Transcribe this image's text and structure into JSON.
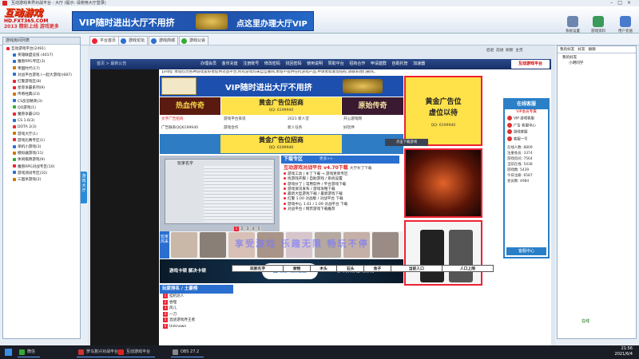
{
  "window": {
    "title": "互动游戏世界对战平台 - 大厅 (提示: 请使用大厅登录)"
  },
  "header": {
    "logo_text": "互动游戏",
    "logo_url": "HD.FXT365.COM",
    "logo_slogan": "2013 精彩上线 游戏更多",
    "banner_left": "VIP随时进出大厅不用挤",
    "banner_right": "点这里办理大厅VIP",
    "tools": [
      {
        "label": "系统设置"
      },
      {
        "label": "游戏资料"
      },
      {
        "label": "用户充值"
      }
    ]
  },
  "tabs": [
    {
      "label": "平台首页"
    },
    {
      "label": "游戏论坛"
    },
    {
      "label": "游戏商城"
    },
    {
      "label": "游戏公会"
    }
  ],
  "left_panel": {
    "title": "游戏房间列表",
    "items": [
      {
        "label": "互动游戏平台(2491)",
        "color": "#e23"
      },
      {
        "label": "英雄联盟竞技 (4017)",
        "color": "#2a6fd0"
      },
      {
        "label": "魔兽RPG专区(3)",
        "color": "#2a6fd0"
      },
      {
        "label": "帝国时代(17)",
        "color": "#c70"
      },
      {
        "label": "对战平台游戏 (一起大游戏)(687)",
        "color": "#2a6fd0"
      },
      {
        "label": "红警游戏区(8)",
        "color": "#e23"
      },
      {
        "label": "星际争霸系列(9)",
        "color": "#e23"
      },
      {
        "label": "传奇经典(23)",
        "color": "#c70"
      },
      {
        "label": "CS反恐精英(3)",
        "color": "#2a6fd0"
      },
      {
        "label": "QQ游戏(1)",
        "color": "#3a3"
      },
      {
        "label": "魔兽争霸(20)",
        "color": "#e23"
      },
      {
        "label": "CS 1.6(3)",
        "color": "#2a6fd0"
      },
      {
        "label": "DOTA 2(3)",
        "color": "#e23"
      },
      {
        "label": "游戏大厅(1)",
        "color": "#c70"
      },
      {
        "label": "游戏比赛专区(1)",
        "color": "#e23"
      },
      {
        "label": "单机小游戏(3)",
        "color": "#2a6fd0"
      },
      {
        "label": "模拟器游戏(11)",
        "color": "#c70"
      },
      {
        "label": "休闲棋牌游戏(9)",
        "color": "#3a3"
      },
      {
        "label": "魔兽RPG对战专区(10)",
        "color": "#e23"
      },
      {
        "label": "游戏测试专区(10)",
        "color": "#2a6fd0"
      },
      {
        "label": "三国杀游戏(2)",
        "color": "#c70"
      }
    ],
    "game_btn": "游戏大厅"
  },
  "nav": {
    "back": "后退",
    "forward": "前进",
    "refresh": "刷新",
    "home": "主页"
  },
  "site": {
    "home": "首页 > 最新公告",
    "nav_items": [
      "办理会员",
      "金币充值",
      "注册账号",
      "修改密码",
      "找回密码",
      "使用说明",
      "赞助平台",
      "招商合作",
      "申请建群",
      "自助托管",
      "加速器"
    ],
    "logo": "互动游戏平台",
    "notice": "【声明】本站仅为各种游戏爱好者提供对战平台,所有游戏均来自互联网,本站不提供任何游戏产品,申请者如发现侵权,请联系我们删除。",
    "banner_text": "VIP随时进出大厅不用挤",
    "ad_left": "热血传奇",
    "ad_mid_title": "黄金广告位招商",
    "ad_mid_sub": "QQ: 6199940",
    "ad_right": "原始传奇",
    "links": [
      {
        "text": "文字广告招商"
      },
      {
        "text": "游戏平台资讯"
      },
      {
        "text": "2021 新人堂"
      },
      {
        "text": "开心游戏网"
      },
      {
        "text": "广告联系QQ6199940"
      },
      {
        "text": "游戏合作"
      },
      {
        "text": "新人任务"
      },
      {
        "text": "好玩伴"
      }
    ],
    "gold_title": "黄金广告位招商",
    "gold_sub": "QQ: 6199940",
    "tooltip": "点击下载游戏"
  },
  "download": {
    "header": "下载专区",
    "more": "更多>>",
    "head": "互动游戏对战平台 v4.70下载",
    "head_tag": "大厅补丁下载",
    "rows": [
      "游戏工具 | 补丁下载 → 游戏更新专区",
      "找游戏开服 / 自助游戏 / 系统设置",
      "游戏补丁 | 常用软件 / 平台游戏下载",
      "游戏资讯发布 / 游戏攻略下载",
      "最新大型游戏下载 / 最新游戏下载",
      "红警 1.00 对战版 / 对战平台 下载",
      "游戏中心 1.61 / 1.09 对战平台 下载",
      "对战平台 / 网页游戏下载推荐"
    ],
    "slide_title": "玩家名字",
    "pages": [
      "1",
      "2",
      "3",
      "4",
      "5"
    ]
  },
  "photos": {
    "label": "玩家风采"
  },
  "promo": {
    "left": "游戏卡顿 解决卡顿",
    "center": "互动游戏加速器",
    "right": "永不掉线 游戏畅玩"
  },
  "watermark": "享受游戏 乐趣无限 畅玩不停",
  "rank": {
    "title": "玩家排名 / 土豪榜",
    "rows": [
      {
        "n": "1",
        "name": "挂机达人"
      },
      {
        "n": "2",
        "name": "吞噬"
      },
      {
        "n": "3",
        "name": "风儿"
      },
      {
        "n": "4",
        "name": "一刀"
      },
      {
        "n": "5",
        "name": "混迹游戏界王者"
      },
      {
        "n": "6",
        "name": "Unknown"
      }
    ]
  },
  "table": {
    "headers": [
      "玩家名字",
      "食物",
      "木头",
      "石头",
      "金子",
      "当前人口",
      "人口上限"
    ]
  },
  "right_ads": {
    "a1_title": "黄金广告位",
    "a1_title2": "虚位以待",
    "a1_sub": "QQ: 6199940"
  },
  "online": {
    "title": "在线客服",
    "sub": "VIP会员专属",
    "items": [
      "VIP 游戏客服",
      "广告 客服中心",
      "游戏客服",
      "客服一号"
    ],
    "stats": [
      "在线人数: 8809",
      "注册会员: 3374",
      "游戏房间: 7564",
      "当前在线: 5438",
      "游戏数: 5439",
      "今日注册: 6587",
      "会员数: 4984"
    ],
    "service": "客服中心"
  },
  "right_panel": {
    "tabs": [
      "我的好友",
      "好友",
      "群聊"
    ],
    "items": [
      "我的好友",
      "小明同学"
    ],
    "status": "在线"
  },
  "taskbar": {
    "items": [
      {
        "label": "微信",
        "color": "#3a3"
      },
      {
        "label": "罗马复兴对战平台",
        "color": "#c33"
      },
      {
        "label": "互动游戏平台",
        "color": "#d22"
      },
      {
        "label": "OBS 27.2",
        "color": "#888"
      }
    ],
    "time": "21:56",
    "date": "2021/6/4"
  }
}
